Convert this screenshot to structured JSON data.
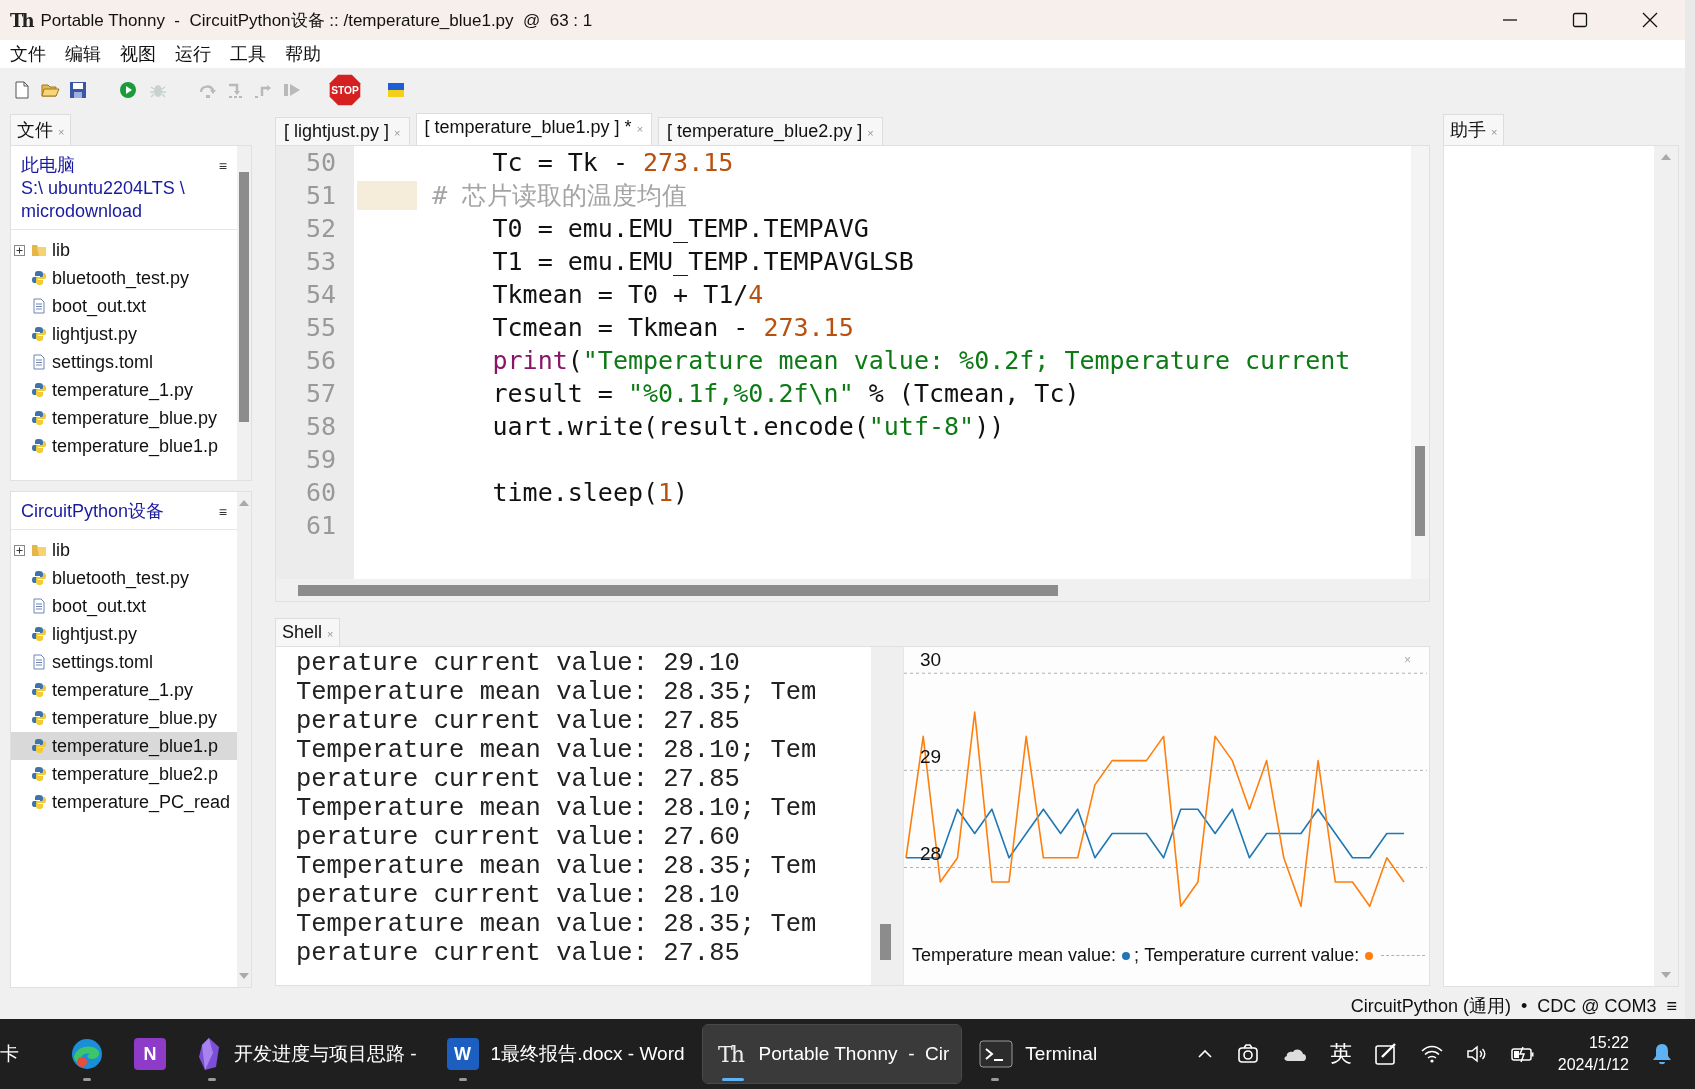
{
  "title_bar": {
    "icon_text": "Th",
    "title": "Portable Thonny  -  CircuitPython设备 :: /temperature_blue1.py  @  63 : 1"
  },
  "menu": [
    "文件",
    "编辑",
    "视图",
    "运行",
    "工具",
    "帮助"
  ],
  "toolbar": [
    {
      "kind": "new",
      "disabled": false
    },
    {
      "kind": "open",
      "disabled": false
    },
    {
      "kind": "save",
      "disabled": false
    },
    {
      "kind": "run",
      "disabled": false
    },
    {
      "kind": "debug",
      "disabled": true
    },
    {
      "kind": "step_over",
      "disabled": true
    },
    {
      "kind": "step_into",
      "disabled": true
    },
    {
      "kind": "step_out",
      "disabled": true
    },
    {
      "kind": "resume",
      "disabled": true
    },
    {
      "kind": "stop",
      "label": "STOP",
      "disabled": false
    },
    {
      "kind": "flag",
      "disabled": false
    }
  ],
  "files_panel": {
    "tab": {
      "label": "文件",
      "close": "×"
    },
    "sections": [
      {
        "title": "此电脑",
        "path": "S:\\ ubuntu2204LTS \\ microdownload",
        "menu_glyph": "≡",
        "items": [
          {
            "name": "lib",
            "kind": "folder",
            "expanded": false,
            "selected": false
          },
          {
            "name": "bluetooth_test.py",
            "kind": "python",
            "selected": false
          },
          {
            "name": "boot_out.txt",
            "kind": "text",
            "selected": false
          },
          {
            "name": "lightjust.py",
            "kind": "python",
            "selected": false
          },
          {
            "name": "settings.toml",
            "kind": "text",
            "selected": false
          },
          {
            "name": "temperature_1.py",
            "kind": "python",
            "selected": false
          },
          {
            "name": "temperature_blue.py",
            "kind": "python",
            "selected": false
          },
          {
            "name": "temperature_blue1.p",
            "kind": "python",
            "selected": false
          }
        ]
      },
      {
        "title": "CircuitPython设备",
        "menu_glyph": "≡",
        "items": [
          {
            "name": "lib",
            "kind": "folder",
            "expanded": false,
            "selected": false
          },
          {
            "name": "bluetooth_test.py",
            "kind": "python",
            "selected": false
          },
          {
            "name": "boot_out.txt",
            "kind": "text",
            "selected": false
          },
          {
            "name": "lightjust.py",
            "kind": "python",
            "selected": false
          },
          {
            "name": "settings.toml",
            "kind": "text",
            "selected": false
          },
          {
            "name": "temperature_1.py",
            "kind": "python",
            "selected": false
          },
          {
            "name": "temperature_blue.py",
            "kind": "python",
            "selected": false
          },
          {
            "name": "temperature_blue1.p",
            "kind": "python",
            "selected": true
          },
          {
            "name": "temperature_blue2.p",
            "kind": "python",
            "selected": false
          },
          {
            "name": "temperature_PC_read",
            "kind": "python",
            "selected": false
          }
        ]
      }
    ]
  },
  "editor": {
    "tabs": [
      {
        "label": "[ lightjust.py ]",
        "close": "×",
        "selected": false
      },
      {
        "label": "[ temperature_blue1.py ] *",
        "close": "×",
        "selected": true
      },
      {
        "label": "[ temperature_blue2.py ]",
        "close": "×",
        "selected": false
      }
    ],
    "lines": [
      {
        "number": "50",
        "indent_highlight": false,
        "tokens": [
          {
            "text": "        Tc = Tk - ",
            "kind": "plain"
          },
          {
            "text": "273.15",
            "kind": "number"
          }
        ]
      },
      {
        "number": "51",
        "indent_highlight": true,
        "tokens": [
          {
            "text": "    # 芯片读取的温度均值",
            "kind": "comment"
          }
        ]
      },
      {
        "number": "52",
        "indent_highlight": false,
        "tokens": [
          {
            "text": "        T0 = emu.EMU_TEMP.TEMPAVG",
            "kind": "plain"
          }
        ]
      },
      {
        "number": "53",
        "indent_highlight": false,
        "tokens": [
          {
            "text": "        T1 = emu.EMU_TEMP.TEMPAVGLSB",
            "kind": "plain"
          }
        ]
      },
      {
        "number": "54",
        "indent_highlight": false,
        "tokens": [
          {
            "text": "        Tkmean = T0 + T1/",
            "kind": "plain"
          },
          {
            "text": "4",
            "kind": "number"
          }
        ]
      },
      {
        "number": "55",
        "indent_highlight": false,
        "tokens": [
          {
            "text": "        Tcmean = Tkmean - ",
            "kind": "plain"
          },
          {
            "text": "273.15",
            "kind": "number"
          }
        ]
      },
      {
        "number": "56",
        "indent_highlight": false,
        "tokens": [
          {
            "text": "        print",
            "kind": "builtin"
          },
          {
            "text": "(",
            "kind": "plain"
          },
          {
            "text": "\"Temperature mean value: %0.2f; Temperature current",
            "kind": "string"
          }
        ]
      },
      {
        "number": "57",
        "indent_highlight": false,
        "tokens": [
          {
            "text": "        result = ",
            "kind": "plain"
          },
          {
            "text": "\"%0.1f,%0.2f\\n\"",
            "kind": "string"
          },
          {
            "text": " % (Tcmean, Tc)",
            "kind": "plain"
          }
        ]
      },
      {
        "number": "58",
        "indent_highlight": false,
        "tokens": [
          {
            "text": "        uart.write(result.encode(",
            "kind": "plain"
          },
          {
            "text": "\"utf-8\"",
            "kind": "string"
          },
          {
            "text": "))",
            "kind": "plain"
          }
        ]
      },
      {
        "number": "59",
        "indent_highlight": false
      },
      {
        "number": "60",
        "indent_highlight": false,
        "tokens": [
          {
            "text": "        time.sleep(",
            "kind": "plain"
          },
          {
            "text": "1",
            "kind": "number"
          },
          {
            "text": ")",
            "kind": "plain"
          }
        ]
      },
      {
        "number": "61",
        "indent_highlight": false
      }
    ]
  },
  "shell": {
    "tab": {
      "label": "Shell",
      "close": "×"
    },
    "lines": [
      "perature current value: 29.10",
      "Temperature mean value: 28.35; Tem",
      "perature current value: 27.85",
      "Temperature mean value: 28.10; Tem",
      "perature current value: 27.85",
      "Temperature mean value: 28.10; Tem",
      "perature current value: 27.60",
      "Temperature mean value: 28.35; Tem",
      "perature current value: 28.10",
      "Temperature mean value: 28.35; Tem",
      "perature current value: 27.85"
    ]
  },
  "plotter": {
    "close": "×",
    "legend_separator": ";",
    "chart_data": {
      "type": "line",
      "ylim": [
        26.79,
        30.27
      ],
      "yticks": [
        28,
        29,
        30
      ],
      "grid": true,
      "series": [
        {
          "name": "Temperature mean value:",
          "color": "#1f77b4",
          "values": [
            28.1,
            28.1,
            28.1,
            28.6,
            28.35,
            28.6,
            28.1,
            28.35,
            28.6,
            28.35,
            28.6,
            28.1,
            28.35,
            28.35,
            28.35,
            28.1,
            28.6,
            28.6,
            28.35,
            28.6,
            28.1,
            28.35,
            28.35,
            28.35,
            28.6,
            28.35,
            28.1,
            28.1,
            28.35,
            28.35
          ]
        },
        {
          "name": "Temperature current value:",
          "color": "#ff7f0e",
          "values": [
            28.1,
            29.35,
            27.85,
            28.1,
            29.6,
            27.85,
            27.85,
            29.35,
            28.1,
            28.1,
            28.1,
            28.85,
            29.1,
            29.1,
            29.1,
            29.35,
            27.6,
            27.85,
            29.35,
            29.1,
            28.6,
            29.1,
            28.1,
            27.6,
            29.1,
            27.85,
            27.85,
            27.6,
            28.1,
            27.85
          ]
        }
      ]
    }
  },
  "assistant": {
    "tab": {
      "label": "助手",
      "close": "×"
    }
  },
  "status_bar": {
    "interpreter": "CircuitPython (通用)",
    "separator": "•",
    "port": "CDC @ COM3",
    "menu_glyph": "≡"
  },
  "taskbar": {
    "items": [
      {
        "kind": "cut_label",
        "label": "卡"
      },
      {
        "kind": "edge",
        "running": true,
        "selected": false
      },
      {
        "kind": "onenote",
        "icon_text": "N",
        "running": false,
        "selected": false
      },
      {
        "kind": "obsidian",
        "label": "开发进度与项目思路 -",
        "running": true,
        "selected": false
      },
      {
        "kind": "word",
        "icon_text": "W",
        "label": "1最终报告.docx - Word",
        "running": true,
        "selected": false
      },
      {
        "kind": "thonny",
        "icon_text": "Th",
        "label": "Portable Thonny  -  Cir",
        "running": true,
        "selected": true
      },
      {
        "kind": "terminal",
        "label": "Terminal",
        "running": true,
        "selected": false
      }
    ],
    "ime": "英",
    "time": "15:22",
    "date": "2024/1/12"
  }
}
